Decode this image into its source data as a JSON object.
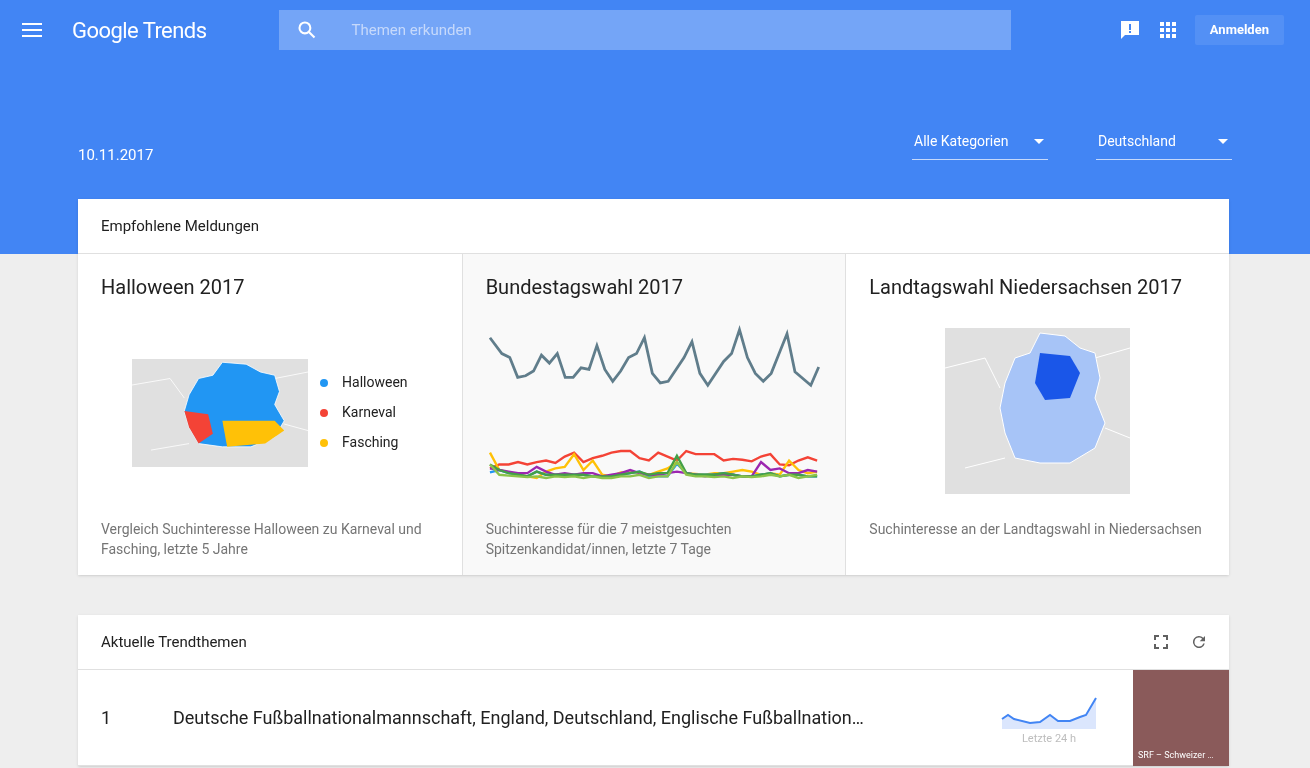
{
  "header": {
    "logo": "Google Trends",
    "search": {
      "placeholder": "Themen erkunden"
    },
    "signin": "Anmelden"
  },
  "date": "10.11.2017",
  "filters": [
    "Alle Kategorien",
    "Deutschland"
  ],
  "featured": {
    "title": "Empfohlene Meldungen",
    "stories": [
      {
        "kind": "map-legend",
        "title": "Halloween 2017",
        "legend": [
          {
            "label": "Halloween",
            "color": "#2196f3"
          },
          {
            "label": "Karneval",
            "color": "#f44336"
          },
          {
            "label": "Fasching",
            "color": "#ffc107"
          }
        ],
        "caption": "Vergleich Suchinteresse Halloween zu Karneval und Fasching, letzte 5 Jahre"
      },
      {
        "kind": "lines",
        "title": "Bundestagswahl 2017",
        "caption": "Suchinteresse für die 7 meistgesuchten Spitzenkandidat/innen, letzte 7 Tage"
      },
      {
        "kind": "map",
        "title": "Landtagswahl Niedersachsen 2017",
        "caption": "Suchinteresse an der Landtagswahl in Niedersachsen"
      }
    ]
  },
  "trending": {
    "title": "Aktuelle Trendthemen",
    "rows": [
      {
        "rank": "1",
        "topic": "Deutsche Fußballnationalmannschaft, England, Deutschland, Englische Fußballnation…",
        "spark_label": "Letzte 24 h",
        "image_caption": "SRF – Schweizer …"
      }
    ]
  }
}
